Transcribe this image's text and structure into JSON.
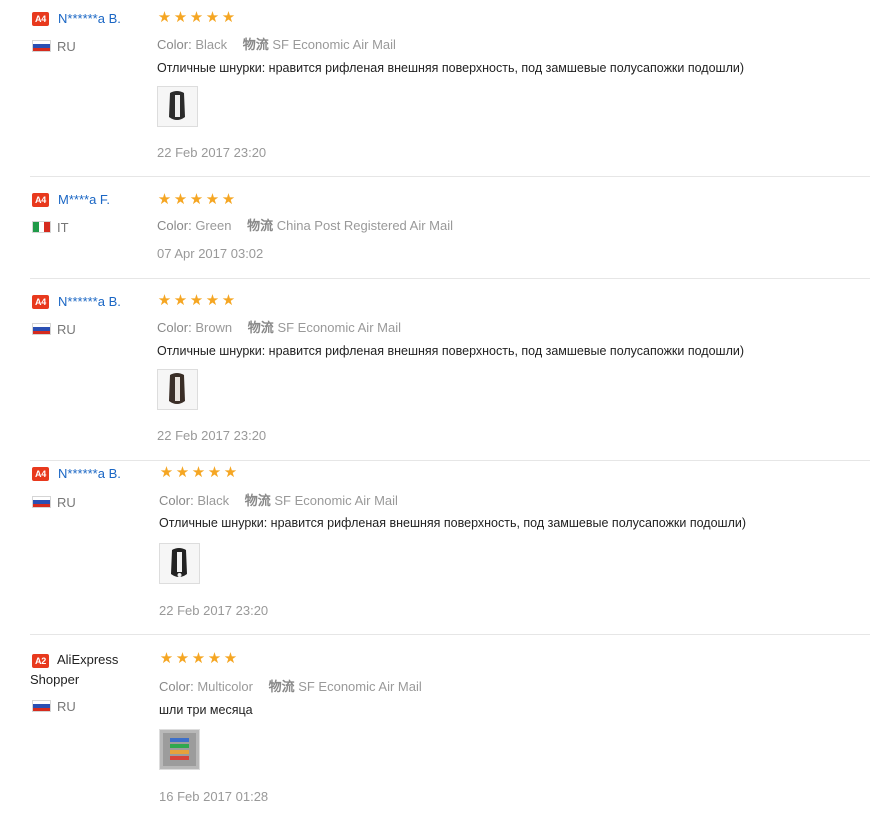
{
  "colors": {
    "accent_star": "#f5a623",
    "badge": "#e8391d",
    "name_link": "#1a66c4"
  },
  "reviews": [
    {
      "level": "A4",
      "name": "N******a B.",
      "country": "RU",
      "flag": "ru-flag-icon",
      "stars": 5,
      "color_label": "Color:",
      "color_value": "Black",
      "ship_label": "物流",
      "shipping": "SF Economic Air Mail",
      "text": "Отличные шнурки: нравится рифленая внешняя поверхность, под замшевые полусапожки подошли)",
      "has_photo": true,
      "date": "22 Feb 2017 23:20"
    },
    {
      "level": "A4",
      "name": "M****a F.",
      "country": "IT",
      "flag": "it-flag-icon",
      "stars": 5,
      "color_label": "Color:",
      "color_value": "Green",
      "ship_label": "物流",
      "shipping": "China Post Registered Air Mail",
      "text": "",
      "has_photo": false,
      "date": "07 Apr 2017 03:02"
    },
    {
      "level": "A4",
      "name": "N******a B.",
      "country": "RU",
      "flag": "ru-flag-icon",
      "stars": 5,
      "color_label": "Color:",
      "color_value": "Brown",
      "ship_label": "物流",
      "shipping": "SF Economic Air Mail",
      "text": "Отличные шнурки: нравится рифленая внешняя поверхность, под замшевые полусапожки подошли)",
      "has_photo": true,
      "date": "22 Feb 2017 23:20"
    },
    {
      "level": "A4",
      "name": "N******a B.",
      "country": "RU",
      "flag": "ru-flag-icon",
      "stars": 5,
      "color_label": "Color:",
      "color_value": "Black",
      "ship_label": "物流",
      "shipping": "SF Economic Air Mail",
      "text": "Отличные шнурки: нравится рифленая внешняя поверхность, под замшевые полусапожки подошли)",
      "has_photo": true,
      "date": "22 Feb 2017 23:20"
    },
    {
      "level": "A2",
      "name": "AliExpress Shopper",
      "country": "RU",
      "flag": "ru-flag-icon",
      "stars": 5,
      "color_label": "Color:",
      "color_value": "Multicolor",
      "ship_label": "物流",
      "shipping": "SF Economic Air Mail",
      "text": "шли три месяца",
      "has_photo": true,
      "date": "16 Feb 2017 01:28"
    }
  ]
}
